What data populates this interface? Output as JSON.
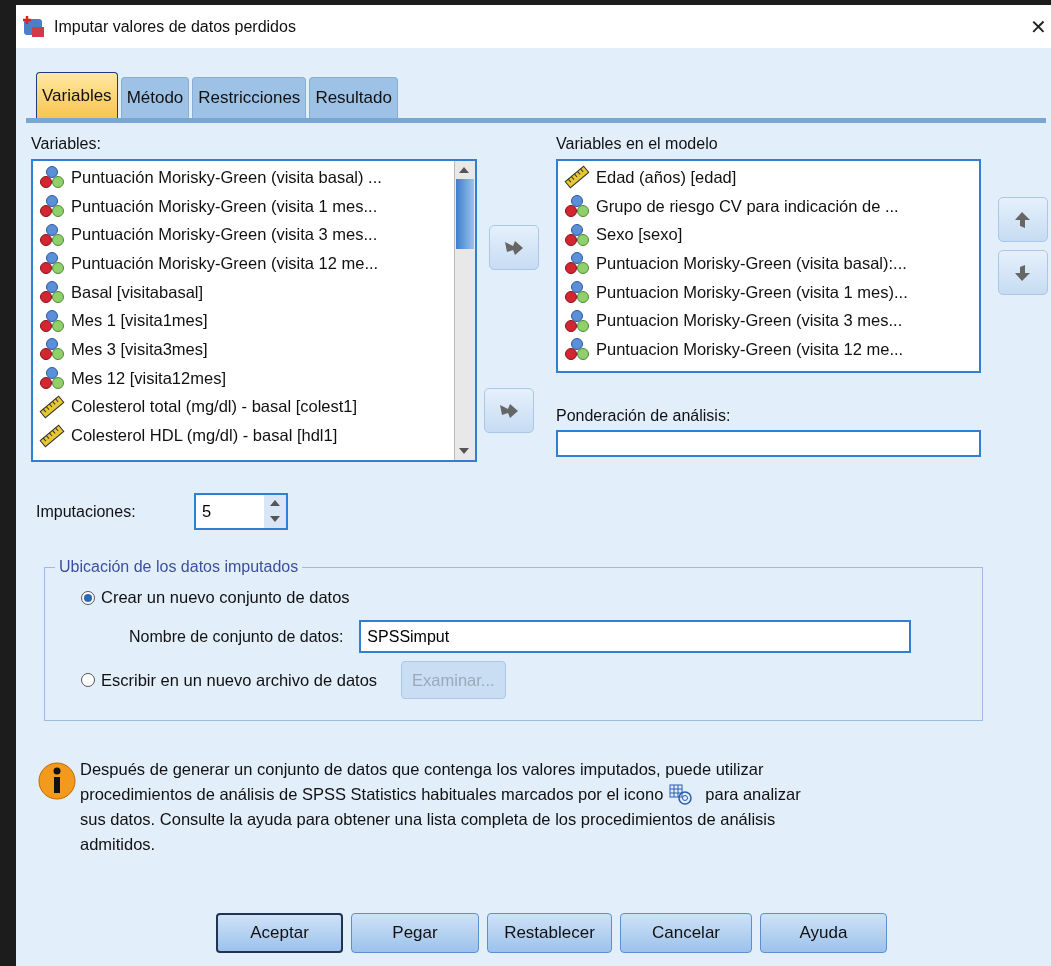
{
  "window": {
    "title": "Imputar valores de datos perdidos",
    "close": "✕"
  },
  "tabs": [
    {
      "label": "Variables",
      "selected": true
    },
    {
      "label": "Método",
      "selected": false
    },
    {
      "label": "Restricciones",
      "selected": false
    },
    {
      "label": "Resultado",
      "selected": false
    }
  ],
  "variables": {
    "label": "Variables:",
    "items": [
      {
        "kind": "nominal",
        "text": "Puntuación Morisky-Green (visita basal) ..."
      },
      {
        "kind": "nominal",
        "text": "Puntuación Morisky-Green (visita 1 mes..."
      },
      {
        "kind": "nominal",
        "text": "Puntuación Morisky-Green (visita 3 mes..."
      },
      {
        "kind": "nominal",
        "text": "Puntuación Morisky-Green (visita 12 me..."
      },
      {
        "kind": "nominal",
        "text": "Basal [visitabasal]"
      },
      {
        "kind": "nominal",
        "text": "Mes 1 [visita1mes]"
      },
      {
        "kind": "nominal",
        "text": "Mes 3 [visita3mes]"
      },
      {
        "kind": "nominal",
        "text": "Mes 12 [visita12mes]"
      },
      {
        "kind": "scale",
        "text": "Colesterol total (mg/dl) - basal [colest1]"
      },
      {
        "kind": "scale",
        "text": "Colesterol HDL (mg/dl) - basal [hdl1]"
      }
    ]
  },
  "model": {
    "label": "Variables en el modelo",
    "items": [
      {
        "kind": "scale",
        "text": "Edad (años) [edad]"
      },
      {
        "kind": "nominal",
        "text": "Grupo de riesgo CV para indicación de ..."
      },
      {
        "kind": "nominal",
        "text": "Sexo [sexo]"
      },
      {
        "kind": "nominal",
        "text": "Puntuacion Morisky-Green (visita basal):..."
      },
      {
        "kind": "nominal",
        "text": "Puntuacion Morisky-Green (visita 1 mes)..."
      },
      {
        "kind": "nominal",
        "text": "Puntuacion Morisky-Green (visita 3 mes..."
      },
      {
        "kind": "nominal",
        "text": "Puntuacion Morisky-Green (visita 12 me..."
      }
    ]
  },
  "weight": {
    "label": "Ponderación de análisis:"
  },
  "imputations": {
    "label": "Imputaciones:",
    "value": "5"
  },
  "location": {
    "title": "Ubicación de los datos imputados",
    "options": [
      {
        "label": "Crear un nuevo conjunto de datos",
        "selected": true
      },
      {
        "label": "Escribir en un nuevo archivo de datos",
        "selected": false
      }
    ],
    "dataset_label": "Nombre de conjunto de datos:",
    "dataset_value": "SPSSimput",
    "browse": {
      "label": "Examinar...",
      "disabled": true
    }
  },
  "info": {
    "lines": [
      {
        "text": "Después de generar un conjunto de datos que contenga los valores imputados, puede utilizar"
      },
      {
        "text": "procedimientos de análisis de SPSS Statistics habituales marcados por el icono",
        "after_icon": "para analizar"
      },
      {
        "text": "sus datos. Consulte la ayuda para obtener una lista completa de los procedimientos de análisis"
      },
      {
        "text": "admitidos."
      }
    ]
  },
  "buttons": [
    {
      "label": "Aceptar",
      "default": true
    },
    {
      "label": "Pegar",
      "default": false
    },
    {
      "label": "Restablecer",
      "default": false
    },
    {
      "label": "Cancelar",
      "default": false
    },
    {
      "label": "Ayuda",
      "default": false
    }
  ]
}
